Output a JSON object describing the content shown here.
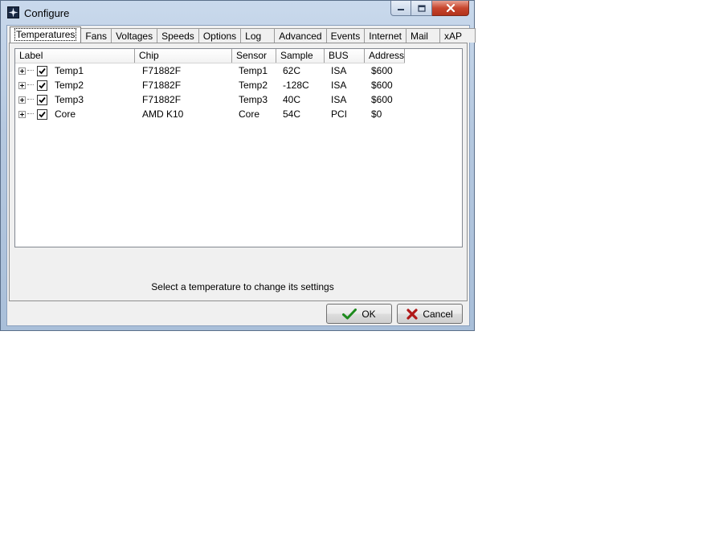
{
  "window": {
    "title": "Configure"
  },
  "icons": {
    "app": "app-icon",
    "minimize": "minimize-icon",
    "maximize": "maximize-icon",
    "close": "close-icon",
    "ok": "checkmark-icon",
    "cancel": "x-cross-icon"
  },
  "tabs": [
    {
      "label": "Temperatures",
      "active": true
    },
    {
      "label": "Fans"
    },
    {
      "label": "Voltages"
    },
    {
      "label": "Speeds"
    },
    {
      "label": "Options"
    },
    {
      "label": "Log"
    },
    {
      "label": "Advanced"
    },
    {
      "label": "Events"
    },
    {
      "label": "Internet"
    },
    {
      "label": "Mail"
    },
    {
      "label": "xAP"
    }
  ],
  "table": {
    "columns": [
      "Label",
      "Chip",
      "Sensor",
      "Sample",
      "BUS",
      "Address"
    ],
    "rows": [
      {
        "label": "Temp1",
        "chip": "F71882F",
        "sensor": "Temp1",
        "sample": "62C",
        "bus": "ISA",
        "address": "$600",
        "checked": true
      },
      {
        "label": "Temp2",
        "chip": "F71882F",
        "sensor": "Temp2",
        "sample": "-128C",
        "bus": "ISA",
        "address": "$600",
        "checked": true
      },
      {
        "label": "Temp3",
        "chip": "F71882F",
        "sensor": "Temp3",
        "sample": "40C",
        "bus": "ISA",
        "address": "$600",
        "checked": true
      },
      {
        "label": "Core",
        "chip": "AMD K10",
        "sensor": "Core",
        "sample": "54C",
        "bus": "PCI",
        "address": "$0",
        "checked": true
      }
    ]
  },
  "status_text": "Select a temperature to change its settings",
  "buttons": {
    "ok": "OK",
    "cancel": "Cancel"
  },
  "colors": {
    "ok_green": "#1d8a1d",
    "cancel_red": "#b01818",
    "close_red": "#c7462e"
  }
}
